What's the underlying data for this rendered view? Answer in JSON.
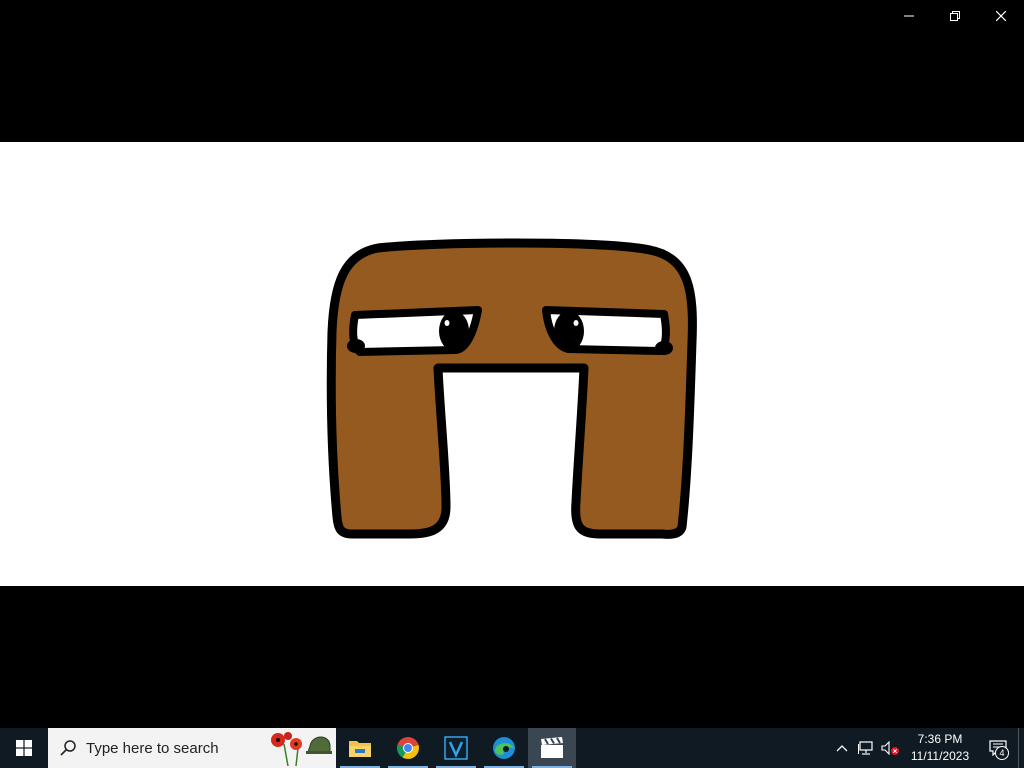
{
  "window": {
    "controls": [
      "minimize-icon",
      "restore-icon",
      "close-icon"
    ]
  },
  "video": {
    "character_fill": "#955a20",
    "outline": "#000000",
    "background": "#ffffff"
  },
  "taskbar": {
    "search_placeholder": "Type here to search",
    "apps": [
      {
        "name": "file-explorer",
        "icon": "folder-icon",
        "running": true
      },
      {
        "name": "chrome",
        "icon": "chrome-icon",
        "running": true
      },
      {
        "name": "v-app",
        "icon": "v-app-icon",
        "running": true
      },
      {
        "name": "edge",
        "icon": "edge-icon",
        "running": true
      },
      {
        "name": "video-editor",
        "icon": "clapperboard-icon",
        "running": true,
        "active": true
      }
    ],
    "clock": {
      "time": "7:36 PM",
      "date": "11/11/2023"
    },
    "notification_count": "4",
    "accent": "#7fb2e0"
  }
}
